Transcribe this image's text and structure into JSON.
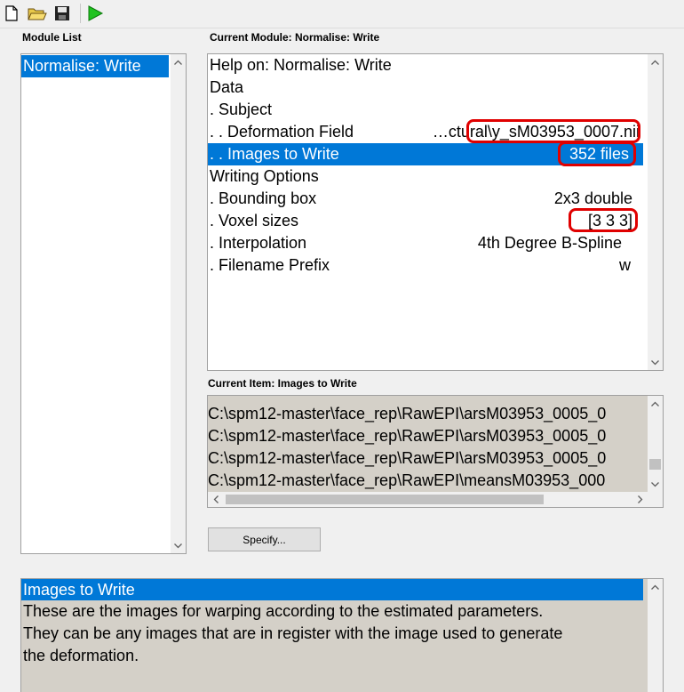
{
  "toolbar": {
    "buttons": [
      {
        "name": "new-file-icon"
      },
      {
        "name": "open-folder-icon"
      },
      {
        "name": "save-icon"
      },
      {
        "name": "run-icon"
      }
    ]
  },
  "module_list": {
    "label": "Module List",
    "items": [
      "Normalise: Write"
    ]
  },
  "current_module": {
    "label": "Current Module: Normalise: Write",
    "rows": [
      {
        "label": "Help on: Normalise: Write",
        "value": ""
      },
      {
        "label": "Data",
        "value": ""
      },
      {
        "label": ". Subject",
        "value": ""
      },
      {
        "label": ". . Deformation Field",
        "value": "…ctural\\y_sM03953_0007.nii"
      },
      {
        "label": ". . Images to Write",
        "value": "352 files"
      },
      {
        "label": "Writing Options",
        "value": ""
      },
      {
        "label": ". Bounding box",
        "value": "2x3 double"
      },
      {
        "label": ". Voxel sizes",
        "value": "[3 3 3]"
      },
      {
        "label": ". Interpolation",
        "value": "4th Degree B-Spline"
      },
      {
        "label": ". Filename Prefix",
        "value": "w"
      }
    ]
  },
  "current_item": {
    "label": "Current Item: Images to Write",
    "files": [
      "C:\\spm12-master\\face_rep\\RawEPI\\arsM03953_0005_0",
      "C:\\spm12-master\\face_rep\\RawEPI\\arsM03953_0005_0",
      "C:\\spm12-master\\face_rep\\RawEPI\\arsM03953_0005_0",
      "C:\\spm12-master\\face_rep\\RawEPI\\meansM03953_000"
    ]
  },
  "specify_button": {
    "label": "Specify..."
  },
  "help": {
    "title": "Images to Write",
    "lines": [
      "These are the images for warping according to the estimated parameters.",
      "They  can  be  any images that are in register with the image used to generate",
      "the deformation."
    ]
  },
  "colors": {
    "selection": "#0078d7",
    "highlight_ring": "#e00000",
    "help_bg": "#d4d0c8"
  }
}
